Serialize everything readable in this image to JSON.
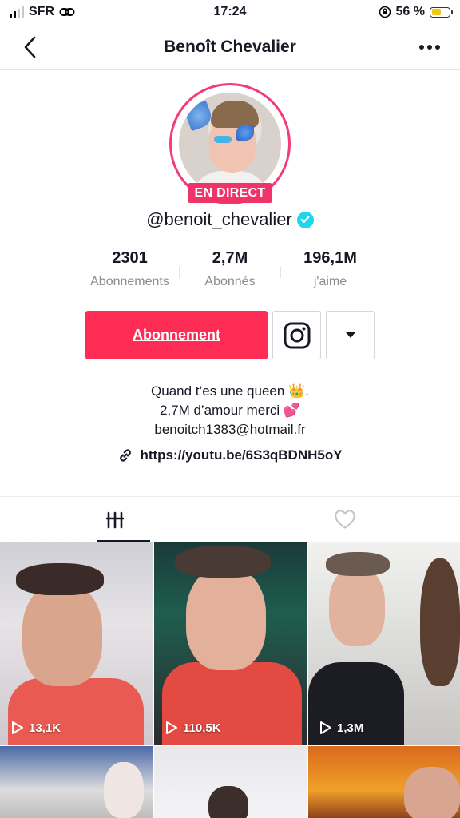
{
  "status_bar": {
    "carrier": "SFR",
    "time": "17:24",
    "battery": "56 %",
    "battery_level": 0.56
  },
  "nav": {
    "title": "Benoît Chevalier",
    "back_icon": "chevron-left-icon",
    "more_icon": "more-dots-icon"
  },
  "profile": {
    "live_badge": "EN DIRECT",
    "handle": "@benoit_chevalier",
    "verified": true
  },
  "stats": [
    {
      "value": "2301",
      "label": "Abonnements"
    },
    {
      "value": "2,7M",
      "label": "Abonnés"
    },
    {
      "value": "196,1M",
      "label": "j'aime"
    }
  ],
  "actions": {
    "follow_label": "Abonnement",
    "instagram_icon": "instagram-icon",
    "dropdown_icon": "caret-down-icon"
  },
  "bio": {
    "line1": "Quand t’es une queen 👑.",
    "line2": "2,7M d’amour merci 💕",
    "line3": "benoitch1383@hotmail.fr",
    "link": "https://youtu.be/6S3qBDNH5oY"
  },
  "tabs": [
    {
      "icon": "grid-icon",
      "active": true
    },
    {
      "icon": "heart-icon",
      "active": false
    }
  ],
  "videos": [
    {
      "views": "13,1K"
    },
    {
      "views": "110,5K"
    },
    {
      "views": "1,3M"
    },
    {
      "views": ""
    },
    {
      "views": ""
    },
    {
      "views": ""
    }
  ],
  "colors": {
    "accent": "#fe2c55",
    "live": "#f0346a",
    "verified": "#20d5ec"
  }
}
